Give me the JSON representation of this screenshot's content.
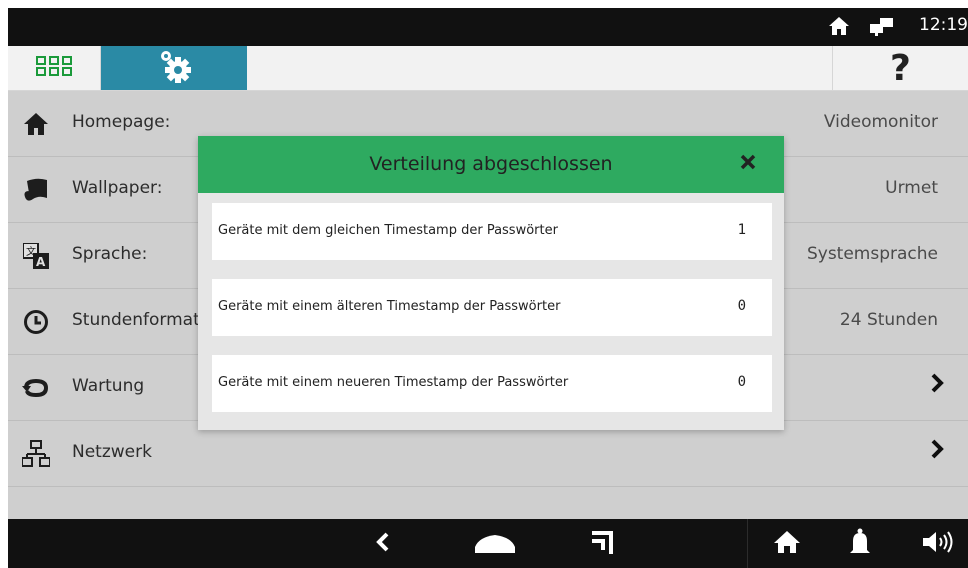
{
  "status_bar": {
    "time": "12:19",
    "icons": [
      "home-icon",
      "network-icon"
    ]
  },
  "tabs": [
    {
      "name": "apps",
      "icon": "apps-grid-icon",
      "active": false
    },
    {
      "name": "settings",
      "icon": "gear-icon",
      "active": true
    },
    {
      "name": "help",
      "label": "?",
      "active": false
    }
  ],
  "settings": [
    {
      "icon": "home-icon",
      "label": "Homepage:",
      "value": "Videomonitor"
    },
    {
      "icon": "wallpaper-icon",
      "label": "Wallpaper:",
      "value": "Urmet"
    },
    {
      "icon": "language-icon",
      "label": "Sprache:",
      "value": "Systemsprache"
    },
    {
      "icon": "clock-icon",
      "label": "Stundenformat:",
      "value": "24 Stunden"
    },
    {
      "icon": "maintenance-icon",
      "label": "Wartung",
      "value": ""
    },
    {
      "icon": "network-icon",
      "label": "Netzwerk",
      "value": ""
    }
  ],
  "dialog": {
    "title": "Verteilung abgeschlossen",
    "rows": [
      {
        "label": "Geräte mit dem gleichen Timestamp der Passwörter",
        "value": "1"
      },
      {
        "label": "Geräte mit einem älteren Timestamp der Passwörter",
        "value": "0"
      },
      {
        "label": "Geräte mit einem neueren Timestamp der Passwörter",
        "value": "0"
      }
    ]
  },
  "nav_bar": {
    "icons": [
      "back-icon",
      "home-icon",
      "recents-icon",
      "house-icon",
      "bell-icon",
      "volume-icon"
    ]
  },
  "colors": {
    "accent_blue": "#2a8aa5",
    "dialog_green": "#2eaa60",
    "apps_green": "#1a9a3a"
  }
}
